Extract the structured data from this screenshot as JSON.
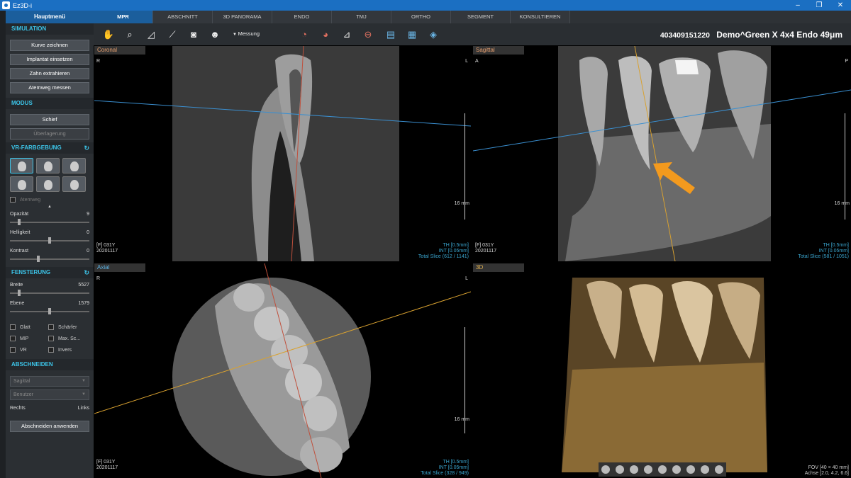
{
  "window": {
    "title": "Ez3D-i",
    "minimize": "–",
    "restore": "❐",
    "close": "✕"
  },
  "sidebar": {
    "main_menu": "Hauptmenü",
    "simulation": {
      "title": "SIMULATION",
      "buttons": [
        "Kurve zeichnen",
        "Implantat einsetzen",
        "Zahn extrahieren",
        "Atemweg messen"
      ]
    },
    "modus": {
      "title": "MODUS",
      "buttons": [
        "Schief",
        "Überlagerung"
      ]
    },
    "vr": {
      "title": "VR-FARBGEBUNG",
      "refresh_icon": "↻",
      "atemweg": "Atemweg",
      "sliders": [
        {
          "label": "Opazität",
          "value": "9",
          "pos": 0.08
        },
        {
          "label": "Helligkeit",
          "value": "0",
          "pos": 0.5
        },
        {
          "label": "Kontrast",
          "value": "0",
          "pos": 0.35
        }
      ]
    },
    "fensterung": {
      "title": "FENSTERUNG",
      "refresh_icon": "↻",
      "sliders": [
        {
          "label": "Breite",
          "value": "5527",
          "pos": 0.1
        },
        {
          "label": "Ebene",
          "value": "1579",
          "pos": 0.5
        }
      ],
      "checkboxes": [
        "Glatt",
        "Schärfer",
        "MIP",
        "Max. Sc...",
        "VR",
        "Invers"
      ]
    },
    "abschneiden": {
      "title": "ABSCHNEIDEN",
      "dropdown1": "Sagittal",
      "dropdown2": "Benutzer",
      "left": "Rechts",
      "right": "Links",
      "apply": "Abschneiden anwenden"
    }
  },
  "tabs": [
    "MPR",
    "ABSCHNITT",
    "3D PANORAMA",
    "ENDO",
    "TMJ",
    "ORTHO",
    "SEGMENT",
    "KONSULTIEREN"
  ],
  "toolbar": {
    "messung": "Messung",
    "patient_id": "403409151220",
    "patient_name": "Demo^Green X 4x4 Endo 49μm"
  },
  "views": {
    "coronal": {
      "label": "Coronal",
      "left": "R",
      "right": "L",
      "info": [
        "[F] 031Y",
        "20201117"
      ],
      "stats": [
        "TH [0.5mm]",
        "INT [0.05mm]",
        "Total Slice (612 / 1141)"
      ],
      "mm": "16 mm"
    },
    "sagittal": {
      "label": "Sagittal",
      "left": "A",
      "right": "P",
      "info": [
        "[F] 031Y",
        "20201117"
      ],
      "stats": [
        "TH [0.5mm]",
        "INT [0.05mm]",
        "Total Slice (581 / 1051)"
      ],
      "mm": "16 mm"
    },
    "axial": {
      "label": "Axial",
      "left": "R",
      "right": "L",
      "info": [
        "[F] 031Y",
        "20201117"
      ],
      "stats": [
        "TH [0.5mm]",
        "INT [0.05mm]",
        "Total Slice (328 / 949)"
      ],
      "mm": "16 mm"
    },
    "threed": {
      "label": "3D",
      "stats": [
        "FOV [40 × 40 mm]",
        "Achse [2.0, 4.2, 6.6]"
      ]
    }
  },
  "colors": {
    "accent": "#1b5e9c",
    "section": "#3cc4e8",
    "arrow": "#f39a1e"
  }
}
